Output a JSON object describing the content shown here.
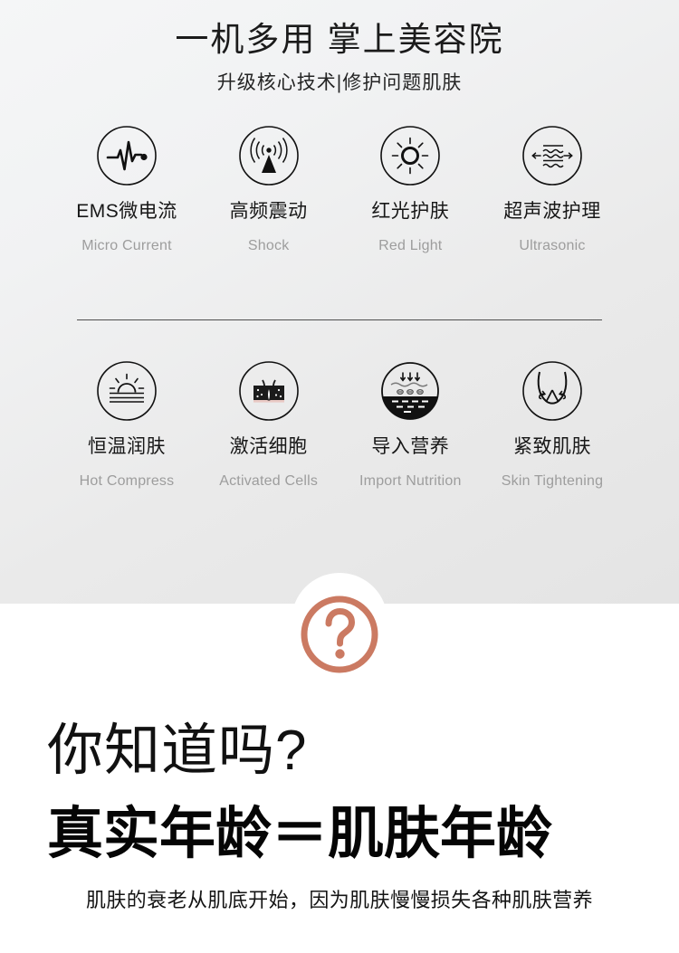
{
  "header": {
    "title": "一机多用 掌上美容院",
    "subtitle": "升级核心技术|修护问题肌肤"
  },
  "features": {
    "row1": [
      {
        "icon": "ecg-pulse-icon",
        "label_cn": "EMS微电流",
        "label_en": "Micro Current"
      },
      {
        "icon": "signal-tower-icon",
        "label_cn": "高频震动",
        "label_en": "Shock"
      },
      {
        "icon": "sun-rays-icon",
        "label_cn": "红光护肤",
        "label_en": "Red Light"
      },
      {
        "icon": "ultrasonic-waves-icon",
        "label_cn": "超声波护理",
        "label_en": "Ultrasonic"
      }
    ],
    "row2": [
      {
        "icon": "sunrise-horizon-icon",
        "label_cn": "恒温润肤",
        "label_en": "Hot Compress"
      },
      {
        "icon": "skin-follicle-icon",
        "label_cn": "激活细胞",
        "label_en": "Activated Cells"
      },
      {
        "icon": "nutrition-absorb-icon",
        "label_cn": "导入营养",
        "label_en": "Import Nutrition"
      },
      {
        "icon": "face-lift-icon",
        "label_cn": "紧致肌肤",
        "label_en": "Skin Tightening"
      }
    ]
  },
  "badge": {
    "icon": "question-mark-circle-icon",
    "symbol": "?",
    "color": "#cb7a62"
  },
  "lower": {
    "know_line": "你知道吗?",
    "age_line": "真实年龄＝肌肤年龄",
    "note_line": "肌肤的衰老从肌底开始，因为肌肤慢慢损失各种肌肤营养"
  },
  "colors": {
    "panel_top": "#f5f6f7",
    "panel_bottom": "#e4e4e4",
    "text_dark": "#171717",
    "text_muted": "#9d9d9d",
    "divider": "#4f4f4f",
    "accent": "#cb7a62"
  }
}
